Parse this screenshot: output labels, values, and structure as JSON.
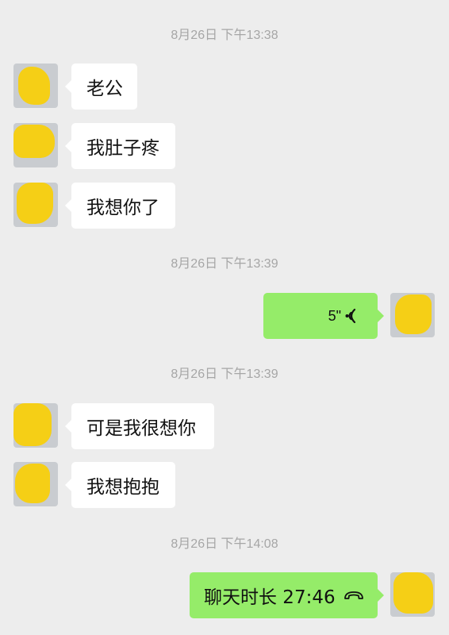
{
  "colors": {
    "background": "#ededed",
    "incoming_bubble": "#ffffff",
    "outgoing_bubble": "#95ec69",
    "timestamp_text": "#a6a6a6",
    "avatar_blur": "#f5cf16"
  },
  "chat": {
    "groups": [
      {
        "timestamp": "8月26日 下午13:38",
        "messages": [
          {
            "sender": "other",
            "type": "text",
            "text": "老公"
          },
          {
            "sender": "other",
            "type": "text",
            "text": "我肚子疼"
          },
          {
            "sender": "other",
            "type": "text",
            "text": "我想你了"
          }
        ]
      },
      {
        "timestamp": "8月26日 下午13:39",
        "messages": [
          {
            "sender": "self",
            "type": "voice",
            "duration": "5\"",
            "icon": "voice-wave-icon"
          }
        ]
      },
      {
        "timestamp": "8月26日 下午13:39",
        "messages": [
          {
            "sender": "other",
            "type": "text",
            "text": "可是我很想你"
          },
          {
            "sender": "other",
            "type": "text",
            "text": "我想抱抱"
          }
        ]
      },
      {
        "timestamp": "8月26日 下午14:08",
        "messages": [
          {
            "sender": "self",
            "type": "call",
            "text": "聊天时长 27:46",
            "icon": "phone-hangup-icon"
          }
        ]
      }
    ]
  }
}
